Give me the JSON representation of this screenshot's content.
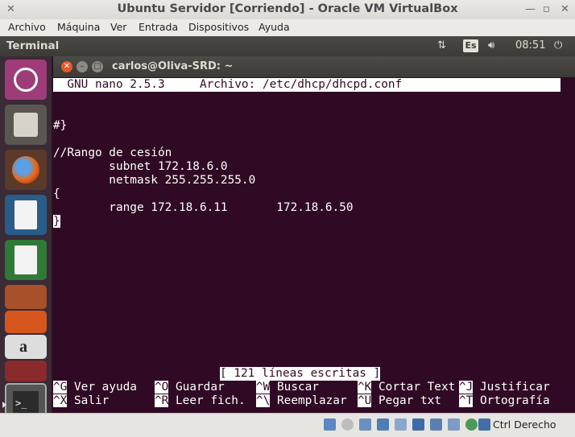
{
  "window": {
    "title": "Ubuntu Servidor [Corriendo] - Oracle VM VirtualBox"
  },
  "menu": [
    "Archivo",
    "Máquina",
    "Ver",
    "Entrada",
    "Dispositivos",
    "Ayuda"
  ],
  "topbar": {
    "app_name": "Terminal",
    "keyboard_layout": "Es",
    "time": "08:51"
  },
  "launcher": [
    "ubuntu-dash",
    "files",
    "firefox",
    "libreoffice-writer",
    "libreoffice-calc",
    "libreoffice-impress",
    "ubuntu-software-center",
    "amazon",
    "system-settings",
    "terminal"
  ],
  "terminal": {
    "title": "carlos@Oliva-SRD: ~",
    "nano_header": "  GNU nano 2.5.3     Archivo: /etc/dhcp/dhcpd.conf",
    "lines": [
      "",
      "#}",
      "",
      "//Rango de cesión",
      "        subnet 172.18.6.0",
      "        netmask 255.255.255.0",
      "{",
      "        range 172.18.6.11       172.18.6.50"
    ],
    "cursor_char": "}",
    "status": "[ 121 líneas escritas ]",
    "shortcuts_row1": [
      {
        "key": "^G",
        "label": "Ver ayuda"
      },
      {
        "key": "^O",
        "label": "Guardar"
      },
      {
        "key": "^W",
        "label": "Buscar"
      },
      {
        "key": "^K",
        "label": "Cortar Text"
      },
      {
        "key": "^J",
        "label": "Justificar"
      }
    ],
    "shortcuts_row2": [
      {
        "key": "^X",
        "label": "Salir"
      },
      {
        "key": "^R",
        "label": "Leer fich."
      },
      {
        "key": "^\\",
        "label": "Reemplazar"
      },
      {
        "key": "^U",
        "label": "Pegar txt"
      },
      {
        "key": "^T",
        "label": "Ortografía"
      }
    ]
  },
  "statusbar": {
    "host_key": "Ctrl Derecho"
  }
}
